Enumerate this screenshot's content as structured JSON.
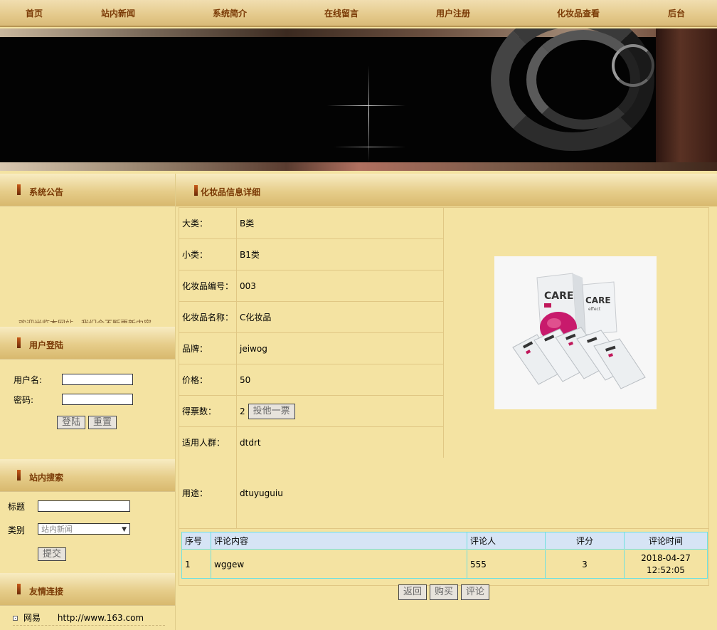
{
  "nav": {
    "items": [
      "首页",
      "站内新闻",
      "系统简介",
      "在线留言",
      "用户注册",
      "化妆品查看",
      "后台"
    ]
  },
  "sidebar": {
    "notice": {
      "title": "系统公告",
      "scroll_text": "欢迎光临本网站，我们会不断更新内容"
    },
    "login": {
      "title": "用户登陆",
      "username_label": "用户名:",
      "password_label": "密码:",
      "username_value": "",
      "password_value": "",
      "login_button": "登陆",
      "reset_button": "重置"
    },
    "search": {
      "title": "站内搜索",
      "keyword_label": "标题",
      "keyword_value": "",
      "category_label": "类别",
      "category_selected": "站内新闻",
      "submit_button": "提交"
    },
    "links": {
      "title": "友情连接",
      "items": [
        {
          "name": "网易",
          "url": "http://www.163.com"
        }
      ]
    }
  },
  "main": {
    "title": "化妆品信息详细",
    "fields": [
      {
        "label": "大类：",
        "value": "B类"
      },
      {
        "label": "小类：",
        "value": "B1类"
      },
      {
        "label": "化妆品编号：",
        "value": "003"
      },
      {
        "label": "化妆品名称：",
        "value": "C化妆品"
      },
      {
        "label": "品牌：",
        "value": "jeiwog"
      },
      {
        "label": "价格：",
        "value": "50"
      },
      {
        "label": "得票数：",
        "value": "2"
      },
      {
        "label": "适用人群：",
        "value": "dtdrt"
      }
    ],
    "vote_button": "投他一票",
    "purpose": {
      "label": "用途：",
      "value": "dtuyuguiu"
    },
    "product_image_text": {
      "brand": "CARE",
      "sub": "effect"
    },
    "comments": {
      "headers": [
        "序号",
        "评论内容",
        "评论人",
        "评分",
        "评论时间"
      ],
      "rows": [
        {
          "no": "1",
          "content": "wggew",
          "author": "555",
          "score": "3",
          "time": "2018-04-27 12:52:05"
        }
      ]
    },
    "actions": {
      "back": "返回",
      "buy": "购买",
      "comment": "评论"
    }
  },
  "colors": {
    "background": "#f4e3a2",
    "nav_text": "#7a3a06",
    "cell_border": "#e0c784",
    "comment_border": "#6fe0e0",
    "comment_header": "#d6e4f5"
  }
}
